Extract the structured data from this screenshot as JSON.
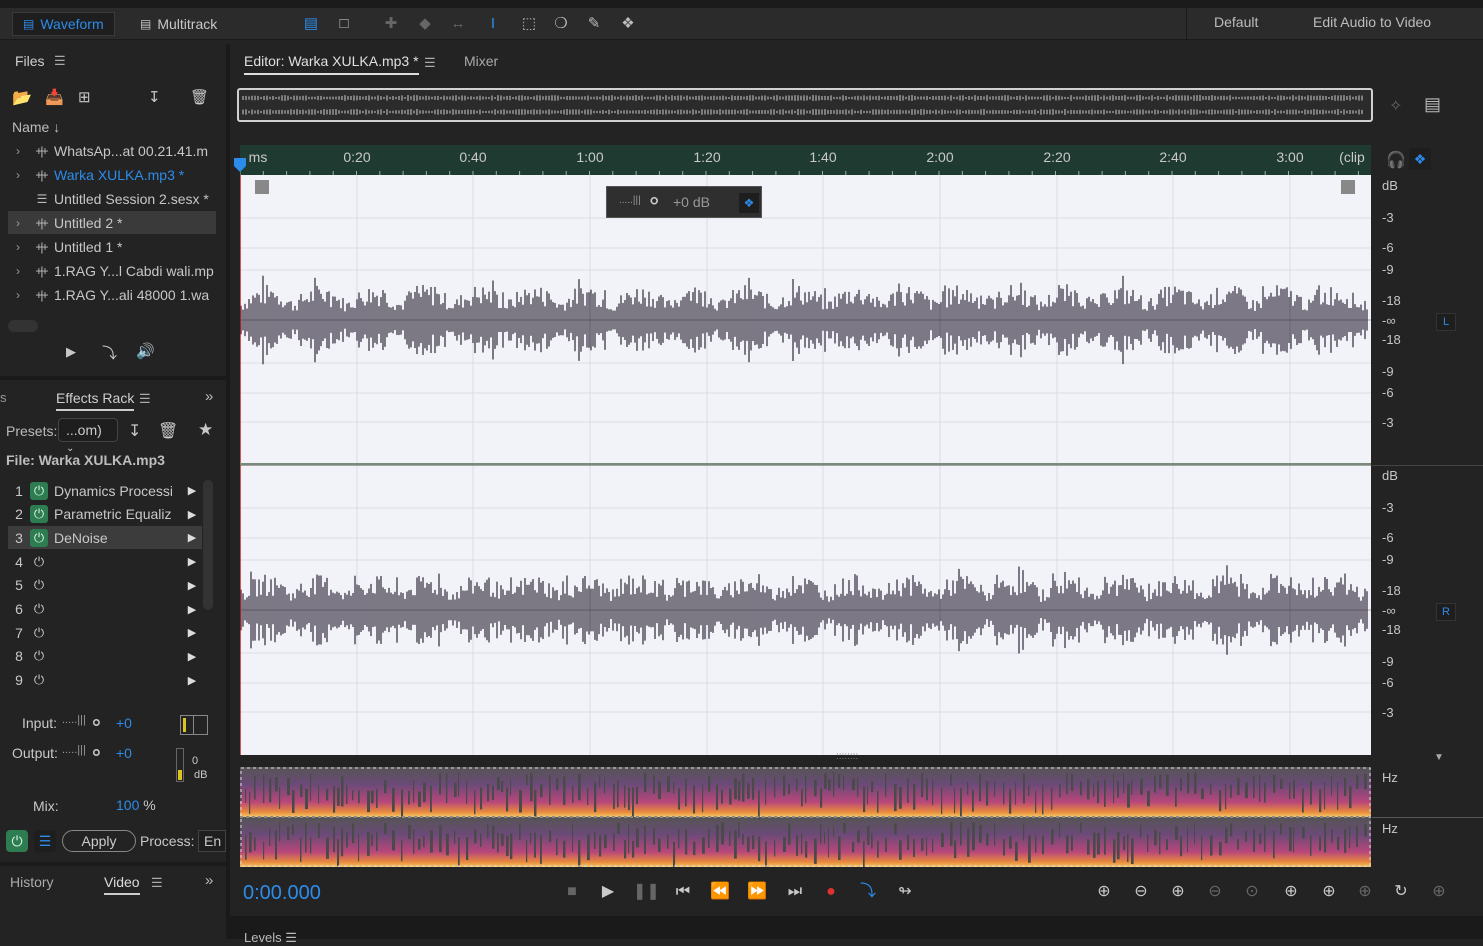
{
  "toolbar": {
    "waveform_label": "Waveform",
    "multitrack_label": "Multitrack",
    "workspace_default": "Default",
    "workspace_edit_video": "Edit Audio to Video"
  },
  "files": {
    "title": "Files",
    "column_name": "Name",
    "items": [
      {
        "label": "WhatsAp...at 00.21.41.m",
        "selected": false,
        "active": false
      },
      {
        "label": "Warka XULKA.mp3 *",
        "selected": false,
        "active": true
      },
      {
        "label": "Untitled Session 2.sesx *",
        "selected": false,
        "active": false
      },
      {
        "label": "Untitled 2 *",
        "selected": true,
        "active": false
      },
      {
        "label": "Untitled 1 *",
        "selected": false,
        "active": false
      },
      {
        "label": "1.RAG Y...l Cabdi wali.mp",
        "selected": false,
        "active": false
      },
      {
        "label": "1.RAG Y...ali 48000 1.wa",
        "selected": false,
        "active": false
      }
    ]
  },
  "effects_rack": {
    "tab_label": "Effects Rack",
    "presets_label": "Presets:",
    "presets_value": "...om)",
    "file_label": "File: Warka XULKA.mp3",
    "slots": [
      {
        "num": "1",
        "name": "Dynamics Processi",
        "on": true
      },
      {
        "num": "2",
        "name": "Parametric Equaliz",
        "on": true
      },
      {
        "num": "3",
        "name": "DeNoise",
        "on": true
      },
      {
        "num": "4",
        "name": "",
        "on": false
      },
      {
        "num": "5",
        "name": "",
        "on": false
      },
      {
        "num": "6",
        "name": "",
        "on": false
      },
      {
        "num": "7",
        "name": "",
        "on": false
      },
      {
        "num": "8",
        "name": "",
        "on": false
      },
      {
        "num": "9",
        "name": "",
        "on": false
      }
    ],
    "input_label": "Input:",
    "input_value": "+0",
    "output_label": "Output:",
    "output_value": "+0",
    "meter_zero": "0",
    "meter_db": "dB",
    "mix_label": "Mix:",
    "mix_value": "100",
    "mix_unit": "%",
    "apply_label": "Apply",
    "process_label": "Process:",
    "process_value": "En"
  },
  "bottom_tabs": {
    "history": "History",
    "video": "Video",
    "levels": "Levels"
  },
  "editor": {
    "tab_label": "Editor: Warka XULKA.mp3 *",
    "mixer_label": "Mixer",
    "hud_gain": "+0 dB",
    "ruler_unit": "ms",
    "ruler_end": "(clip",
    "ruler_ticks": [
      "0:20",
      "0:40",
      "1:00",
      "1:20",
      "1:40",
      "2:00",
      "2:20",
      "2:40",
      "3:00"
    ],
    "db_labels_top": [
      "dB",
      "-3",
      "-6",
      "-9",
      "-18",
      "-∞",
      "-18",
      "-9",
      "-6",
      "-3"
    ],
    "db_labels_bottom": [
      "dB",
      "-3",
      "-6",
      "-9",
      "-18",
      "-∞",
      "-18",
      "-9",
      "-6",
      "-3"
    ],
    "channel_l": "L",
    "channel_r": "R",
    "hz_label": "Hz",
    "time_display": "0:00.000"
  },
  "colors": {
    "accent": "#2d8ceb",
    "waveform": "#2e2638",
    "wave_bg": "#f2f3f8",
    "ruler_bg": "#1f3a30",
    "power_on": "#2e7d51",
    "record": "#e03030"
  }
}
